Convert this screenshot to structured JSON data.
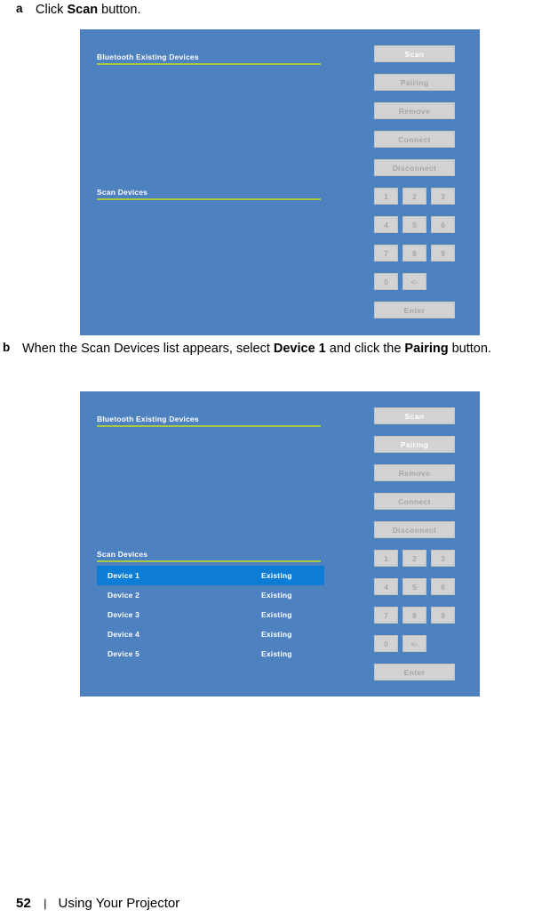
{
  "document": {
    "footer": {
      "page_number": "52",
      "separator": "|",
      "title": "Using Your Projector"
    }
  },
  "steps": [
    {
      "marker": "a",
      "text_parts": [
        {
          "text": "Click ",
          "bold": false
        },
        {
          "text": "Scan",
          "bold": true
        },
        {
          "text": " button.",
          "bold": false
        }
      ]
    },
    {
      "marker": "b",
      "text_parts": [
        {
          "text": "When the Scan Devices list appears, select ",
          "bold": false
        },
        {
          "text": "Device 1",
          "bold": true
        },
        {
          "text": " and click the ",
          "bold": false
        },
        {
          "text": "Pairing",
          "bold": true
        },
        {
          "text": " button.",
          "bold": false
        }
      ]
    }
  ],
  "colors": {
    "panel_background": "#4d81bf",
    "rule_green": "#a7c942",
    "button_face": "#d2d2d2",
    "button_label_disabled": "#a6a6a6",
    "button_label_enabled": "#ffffff",
    "row_selected": "#0c7cd5"
  },
  "panels": [
    {
      "id": "scan",
      "existing_devices": {
        "title": "Bluetooth Existing Devices",
        "items": []
      },
      "scan_devices": {
        "title": "Scan Devices",
        "items": []
      },
      "actions": [
        {
          "label": "Scan",
          "enabled": true
        },
        {
          "label": "Pairing",
          "enabled": false
        },
        {
          "label": "Remove",
          "enabled": false
        },
        {
          "label": "Connect",
          "enabled": false
        },
        {
          "label": "Disconnect",
          "enabled": false
        }
      ],
      "keypad": {
        "keys": [
          "1",
          "2",
          "3",
          "4",
          "5",
          "6",
          "7",
          "8",
          "9",
          "0",
          "<-"
        ],
        "enter_label": "Enter"
      }
    },
    {
      "id": "pairing",
      "existing_devices": {
        "title": "Bluetooth Existing Devices",
        "items": []
      },
      "scan_devices": {
        "title": "Scan Devices",
        "items": [
          {
            "name": "Device 1",
            "status": "Existing",
            "selected": true
          },
          {
            "name": "Device 2",
            "status": "Existing",
            "selected": false
          },
          {
            "name": "Device 3",
            "status": "Existing",
            "selected": false
          },
          {
            "name": "Device 4",
            "status": "Existing",
            "selected": false
          },
          {
            "name": "Device 5",
            "status": "Existing",
            "selected": false
          }
        ]
      },
      "actions": [
        {
          "label": "Scan",
          "enabled": true
        },
        {
          "label": "Pairing",
          "enabled": true
        },
        {
          "label": "Remove",
          "enabled": false
        },
        {
          "label": "Connect",
          "enabled": false
        },
        {
          "label": "Disconnect",
          "enabled": false
        }
      ],
      "keypad": {
        "keys": [
          "1",
          "2",
          "3",
          "4",
          "5",
          "6",
          "7",
          "8",
          "9",
          "0",
          "<-"
        ],
        "enter_label": "Enter"
      }
    }
  ]
}
